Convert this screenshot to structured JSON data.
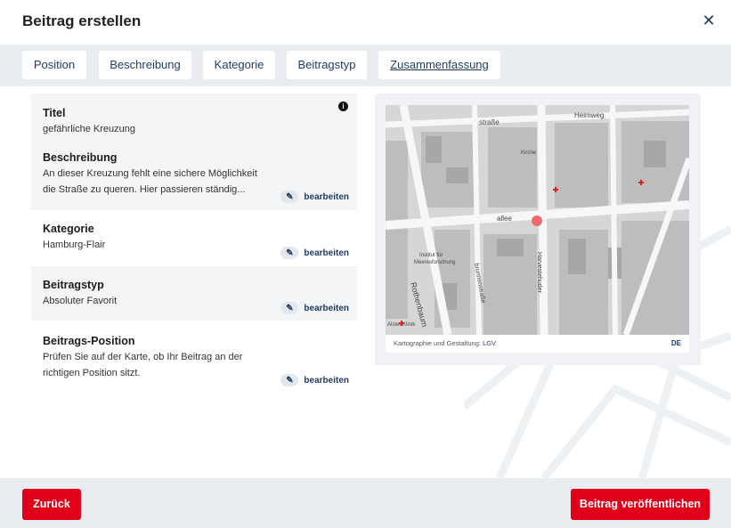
{
  "dialog": {
    "title": "Beitrag erstellen",
    "close_icon": "close-icon"
  },
  "tabs": [
    {
      "label": "Position"
    },
    {
      "label": "Beschreibung"
    },
    {
      "label": "Kategorie"
    },
    {
      "label": "Beitragstyp"
    },
    {
      "label": "Zusammenfassung",
      "active": true
    }
  ],
  "summary": {
    "titel": {
      "heading": "Titel",
      "value": "gefährliche Kreuzung"
    },
    "beschreibung": {
      "heading": "Beschreibung",
      "line1": "An dieser Kreuzung fehlt eine sichere Möglichkeit",
      "line2": "die Straße zu queren. Hier passieren ständig..."
    },
    "kategorie": {
      "heading": "Kategorie",
      "value": "Hamburg-Flair"
    },
    "beitragstyp": {
      "heading": "Beitragstyp",
      "value": "Absoluter Favorit"
    },
    "position": {
      "heading": "Beitrags-Position",
      "line1": "Prüfen Sie auf der Karte, ob Ihr Beitrag an der",
      "line2": "richtigen Position sitzt."
    },
    "edit_label": "bearbeiten"
  },
  "map": {
    "streets": [
      "straße",
      "Heimweg",
      "allee",
      "Rothenbaum",
      "brunnenstraße",
      "Harvestehuder",
      "Institut für Meeresforschung",
      "Alster Klinik",
      "Kirche"
    ],
    "attribution_prefix": "Kartographie und Gestaltung:",
    "attribution_link": "LGV",
    "language": "DE",
    "marker_color": "#f06a6a"
  },
  "footer": {
    "back_label": "Zurück",
    "publish_label": "Beitrag veröffentlichen"
  },
  "colors": {
    "accent": "#e10019",
    "navy": "#1f3a5f",
    "panel": "#e9edf2"
  }
}
